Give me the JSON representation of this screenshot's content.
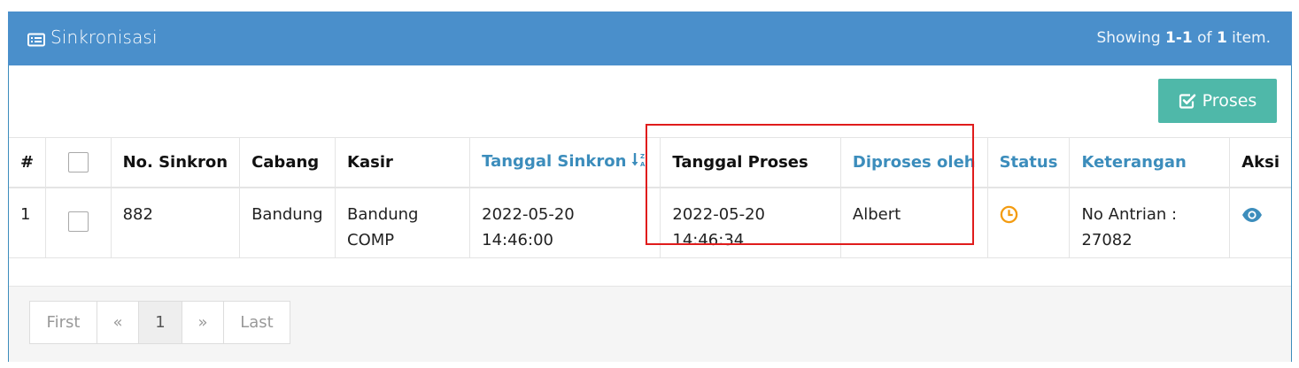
{
  "panel": {
    "title": "Sinkronisasi",
    "title_icon": "list-alt-icon",
    "summary": {
      "prefix": "Showing ",
      "range": "1-1",
      "of": " of ",
      "total": "1",
      "suffix": " item."
    }
  },
  "toolbar": {
    "proses_label": "Proses",
    "proses_icon": "check-square-icon",
    "proses_color": "#4fb8a9"
  },
  "table": {
    "headers": {
      "num": "#",
      "no_sinkron": "No. Sinkron",
      "cabang": "Cabang",
      "kasir": "Kasir",
      "tanggal_sinkron": "Tanggal Sinkron",
      "tanggal_proses": "Tanggal Proses",
      "diproses_oleh": "Diproses oleh",
      "status": "Status",
      "keterangan": "Keterangan",
      "aksi": "Aksi"
    },
    "rows": [
      {
        "num": "1",
        "no_sinkron": "882",
        "cabang": "Bandung",
        "kasir_line1": "Bandung",
        "kasir_line2": "COMP",
        "tanggal_sinkron": "2022-05-20 14:46:00",
        "tanggal_proses_line1": "2022-05-20",
        "tanggal_proses_line2": "14:46:34",
        "diproses_oleh": "Albert",
        "status_icon": "clock-icon",
        "keterangan_line1": "No Antrian :",
        "keterangan_line2": "27082",
        "aksi_icon": "eye-icon"
      }
    ]
  },
  "pagination": {
    "first": "First",
    "prev": "«",
    "current": "1",
    "next": "»",
    "last": "Last"
  },
  "colors": {
    "header": "#4a8fcb",
    "link": "#3c8dbc",
    "status_pending": "#f39c12",
    "highlight": "#e01c1c"
  }
}
